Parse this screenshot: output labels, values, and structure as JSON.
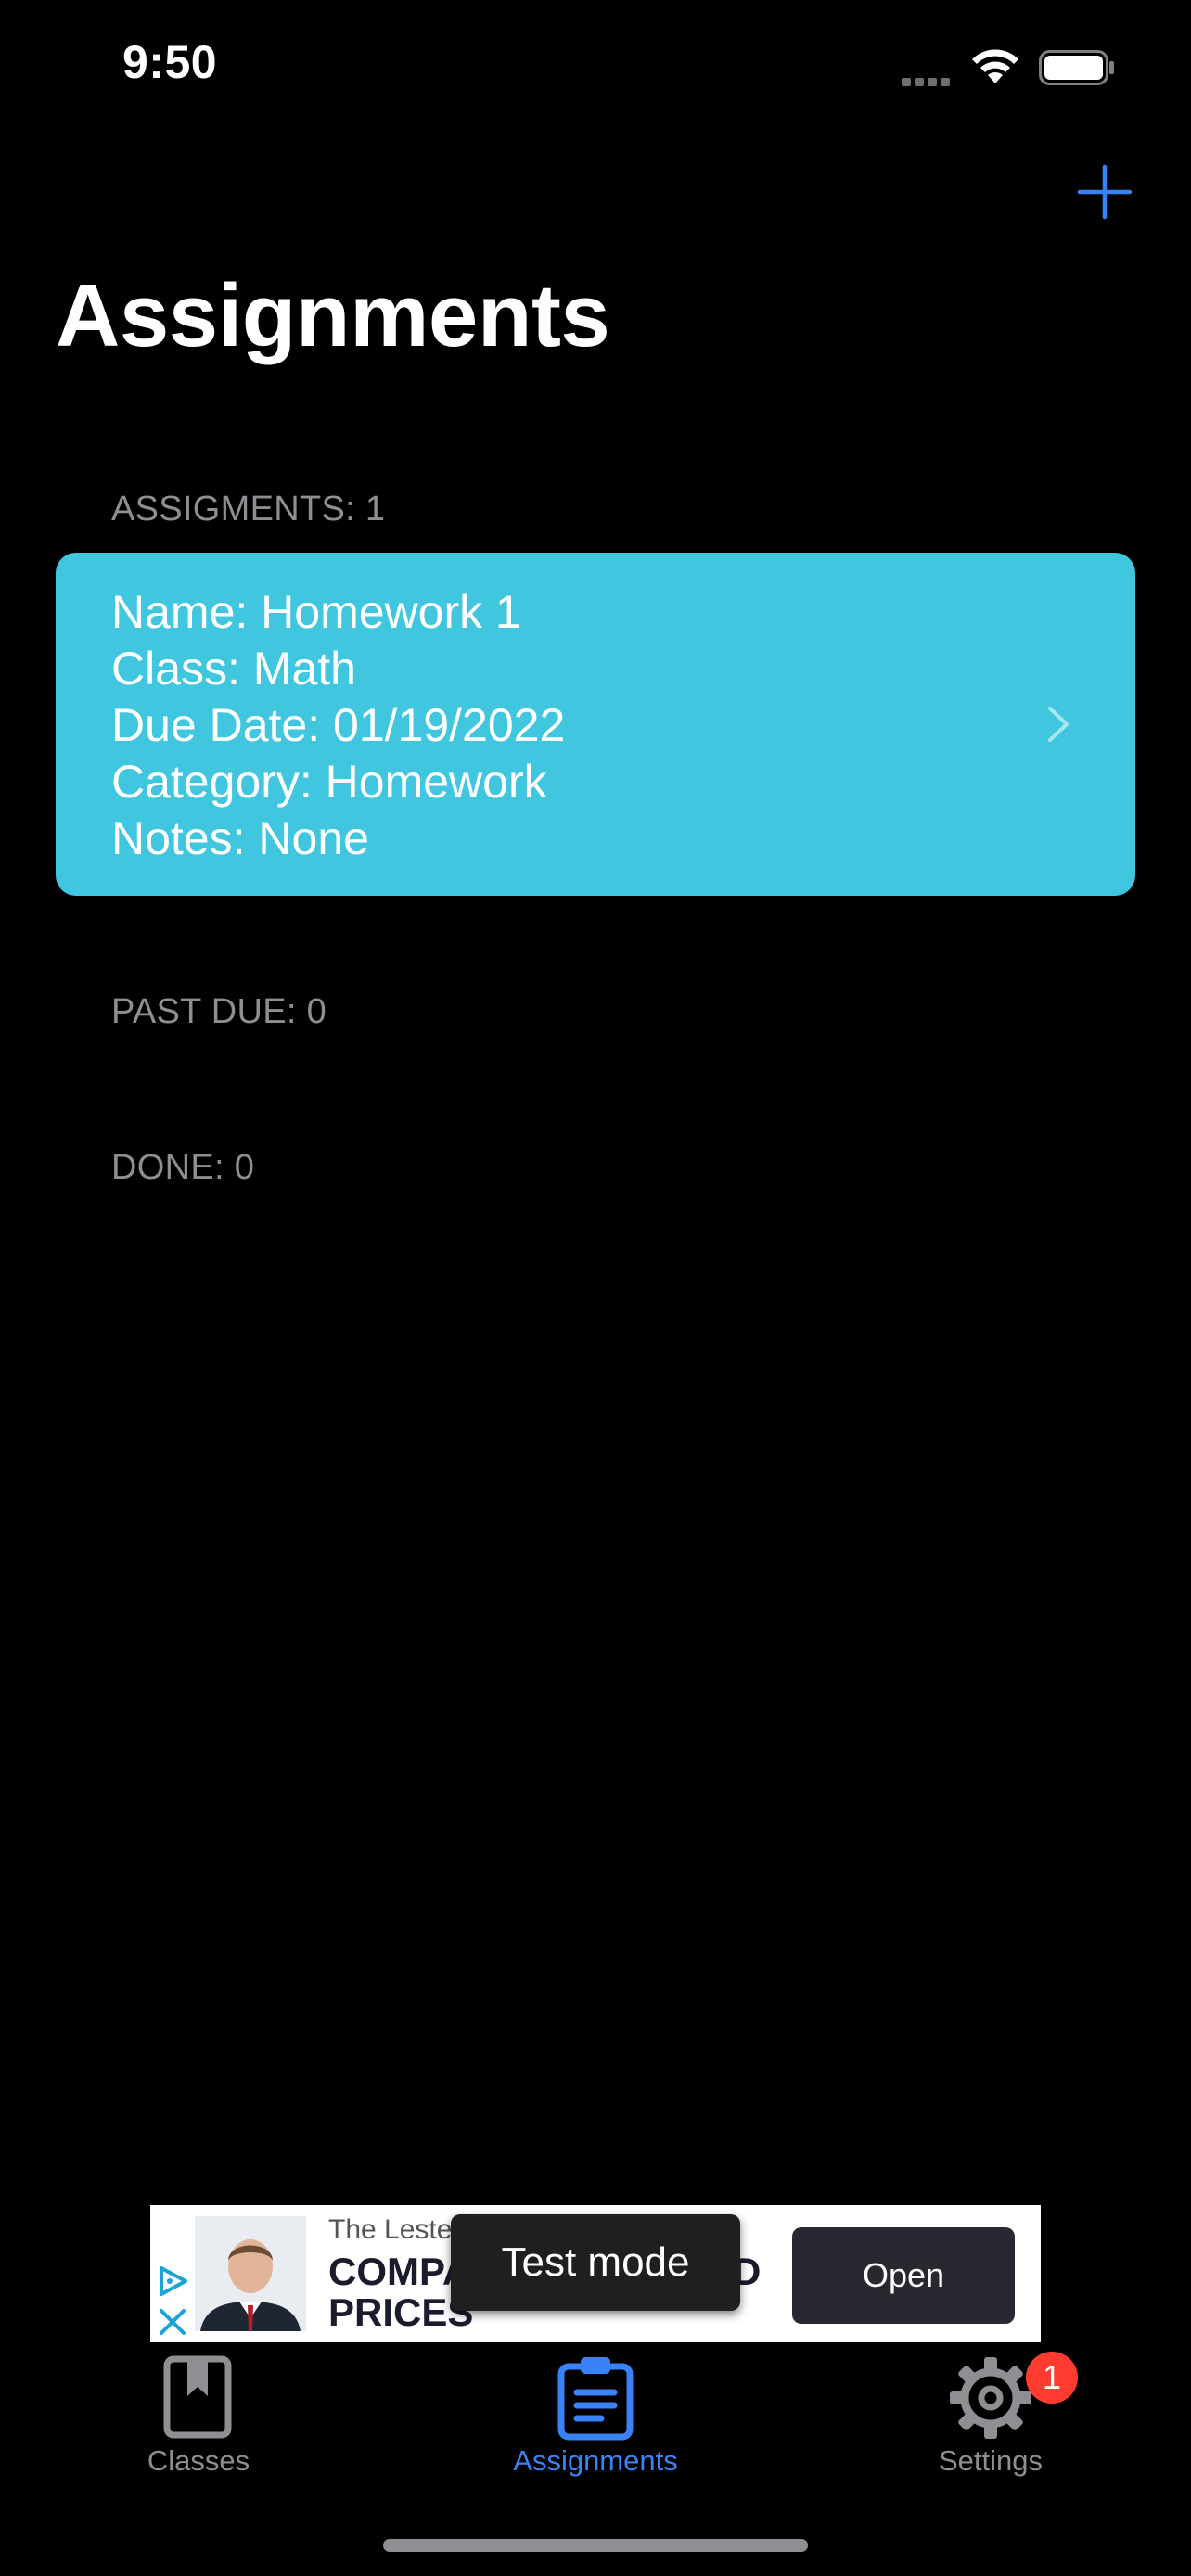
{
  "status_bar": {
    "time": "9:50"
  },
  "header": {
    "title": "Assignments",
    "add_icon": "plus-icon"
  },
  "sections": {
    "assignments_header": "ASSIGMENTS: 1",
    "past_due_header": "PAST DUE: 0",
    "done_header": "DONE: 0"
  },
  "assignment": {
    "name": "Name: Homework 1",
    "class": "Class: Math",
    "due_date": "Due Date: 01/19/2022",
    "category": "Category: Homework",
    "notes": "Notes: None",
    "color": "#41c6df"
  },
  "ad": {
    "advertiser": "The Lester",
    "headline_line1": "COMPA",
    "headline_line2": "PRICES",
    "headline_right": "D",
    "open_label": "Open",
    "test_mode_label": "Test mode"
  },
  "tab_bar": {
    "tabs": [
      {
        "label": "Classes",
        "icon": "book-icon",
        "active": false
      },
      {
        "label": "Assignments",
        "icon": "clipboard-icon",
        "active": true
      },
      {
        "label": "Settings",
        "icon": "gear-icon",
        "active": false
      }
    ],
    "settings_badge": "1",
    "active_color": "#3a82f7",
    "inactive_color": "#8e8e93"
  }
}
